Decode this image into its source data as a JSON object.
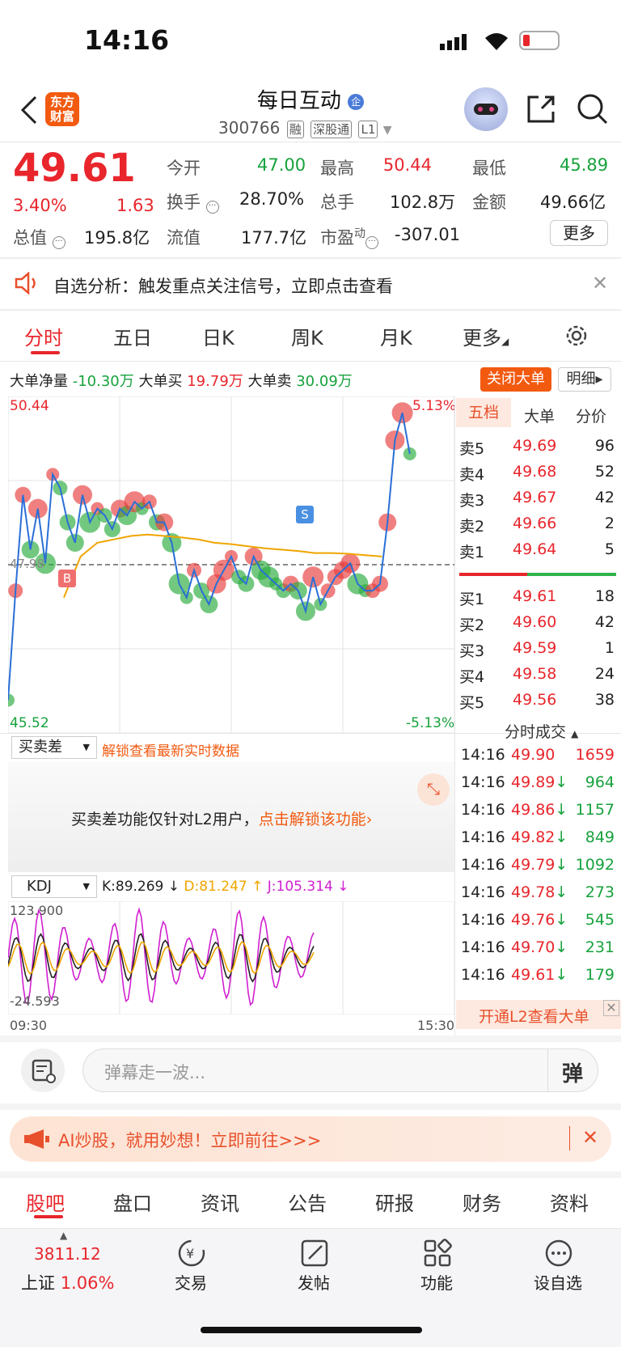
{
  "status_bar": {
    "time": "14:16"
  },
  "header": {
    "logo": "东方\n财富",
    "stock_name": "每日互动",
    "stock_code": "300766",
    "tags": [
      "融",
      "深股通",
      "L1"
    ]
  },
  "quote": {
    "price": "49.61",
    "change_pct": "3.40%",
    "change": "1.63",
    "open_label": "今开",
    "open": "47.00",
    "high_label": "最高",
    "high": "50.44",
    "low_label": "最低",
    "low": "45.89",
    "turnover_label": "换手",
    "turnover": "28.70%",
    "volume_label": "总手",
    "volume": "102.8万",
    "amount_label": "金额",
    "amount": "49.66亿",
    "mktcap_label": "总值",
    "mktcap": "195.8亿",
    "float_label": "流值",
    "float": "177.7亿",
    "pe_label": "市盈",
    "pe_sup": "动",
    "pe": "-307.01",
    "more": "更多"
  },
  "notice": {
    "text": "自选分析：触发重点关注信号，立即点击查看"
  },
  "tabs": [
    "分时",
    "五日",
    "日K",
    "周K",
    "月K",
    "更多"
  ],
  "bigorder": {
    "net_label": "大单净量",
    "net": "-10.30万",
    "buy_label": "大单买",
    "buy": "19.79万",
    "sell_label": "大单卖",
    "sell": "30.09万",
    "close_btn": "关闭大单",
    "detail_btn": "明细"
  },
  "chart": {
    "y_top": "50.44",
    "y_bottom": "45.52",
    "pct_top": "5.13%",
    "pct_bottom": "-5.13%",
    "prev_close": "47.98",
    "buy_marker": "B",
    "sell_marker": "S"
  },
  "chart_data": {
    "type": "line",
    "ylim": [
      45.52,
      50.44
    ],
    "x": [
      0,
      4,
      8,
      12,
      16,
      20,
      24,
      28,
      32,
      36,
      40,
      44,
      48,
      52,
      56,
      60,
      64,
      68,
      72,
      76,
      80,
      84,
      88,
      92,
      96,
      100,
      104,
      108,
      112,
      116,
      120,
      124,
      128,
      132,
      136,
      140,
      144,
      148,
      152,
      156,
      160,
      164,
      168,
      172,
      176,
      180,
      184,
      188,
      192,
      196,
      200,
      204,
      208,
      212,
      216,
      220,
      224,
      228,
      232,
      236,
      240
    ],
    "values": [
      46.0,
      47.6,
      49.0,
      48.2,
      48.8,
      48.0,
      49.3,
      49.1,
      48.6,
      48.3,
      49.0,
      48.6,
      48.8,
      48.7,
      48.5,
      48.8,
      48.7,
      48.9,
      48.8,
      48.9,
      48.6,
      48.6,
      48.3,
      47.7,
      47.5,
      47.9,
      47.6,
      47.4,
      47.7,
      47.9,
      48.1,
      47.8,
      47.7,
      48.1,
      47.9,
      47.8,
      47.7,
      47.6,
      47.7,
      47.6,
      47.3,
      47.8,
      47.4,
      47.6,
      47.8,
      47.9,
      48.0,
      47.7,
      47.6,
      47.6,
      47.7,
      48.6,
      49.8,
      50.2,
      49.6
    ],
    "avg_line": [
      47.5,
      48.1,
      48.3,
      48.35,
      48.4,
      48.42,
      48.4,
      48.38,
      48.35,
      48.3,
      48.28,
      48.25,
      48.22,
      48.2,
      48.18,
      48.15,
      48.15,
      48.14,
      48.12,
      48.1
    ]
  },
  "buysell": {
    "select": "买卖差",
    "unlock": "解锁查看最新实时数据",
    "msg": "买卖差功能仅针对L2用户，",
    "link": "点击解锁该功能"
  },
  "kdj": {
    "select": "KDJ",
    "k": "K:89.269 ↓",
    "d": "D:81.247 ↑",
    "j": "J:105.314 ↓",
    "max": "123.900",
    "min": "-24.593",
    "t_start": "09:30",
    "t_end": "15:30"
  },
  "orderbook": {
    "tabs": [
      "五档",
      "大单",
      "分价"
    ],
    "asks": [
      {
        "label": "卖5",
        "price": "49.69",
        "vol": "96"
      },
      {
        "label": "卖4",
        "price": "49.68",
        "vol": "52"
      },
      {
        "label": "卖3",
        "price": "49.67",
        "vol": "42"
      },
      {
        "label": "卖2",
        "price": "49.66",
        "vol": "2"
      },
      {
        "label": "卖1",
        "price": "49.64",
        "vol": "5"
      }
    ],
    "bids": [
      {
        "label": "买1",
        "price": "49.61",
        "vol": "18"
      },
      {
        "label": "买2",
        "price": "49.60",
        "vol": "42"
      },
      {
        "label": "买3",
        "price": "49.59",
        "vol": "1"
      },
      {
        "label": "买4",
        "price": "49.58",
        "vol": "24"
      },
      {
        "label": "买5",
        "price": "49.56",
        "vol": "38"
      }
    ]
  },
  "trades": {
    "title": "分时成交",
    "rows": [
      {
        "t": "14:16",
        "p": "49.90",
        "arrow": "",
        "v": "1659",
        "c": "red"
      },
      {
        "t": "14:16",
        "p": "49.89",
        "arrow": "↓",
        "v": "964",
        "c": "green"
      },
      {
        "t": "14:16",
        "p": "49.86",
        "arrow": "↓",
        "v": "1157",
        "c": "green"
      },
      {
        "t": "14:16",
        "p": "49.82",
        "arrow": "↓",
        "v": "849",
        "c": "green"
      },
      {
        "t": "14:16",
        "p": "49.79",
        "arrow": "↓",
        "v": "1092",
        "c": "green"
      },
      {
        "t": "14:16",
        "p": "49.78",
        "arrow": "↓",
        "v": "273",
        "c": "green"
      },
      {
        "t": "14:16",
        "p": "49.76",
        "arrow": "↓",
        "v": "545",
        "c": "green"
      },
      {
        "t": "14:16",
        "p": "49.70",
        "arrow": "↓",
        "v": "231",
        "c": "green"
      },
      {
        "t": "14:16",
        "p": "49.61",
        "arrow": "↓",
        "v": "179",
        "c": "green"
      }
    ],
    "l2_banner": "开通L2查看大单"
  },
  "danmu": {
    "placeholder": "弹幕走一波...",
    "btn": "弹"
  },
  "ai_banner": {
    "text": "AI炒股，就用妙想！立即前往>>>"
  },
  "bottom_tabs": [
    "股吧",
    "盘口",
    "资讯",
    "公告",
    "研报",
    "财务",
    "资料"
  ],
  "bottom_nav": {
    "index_value": "3811.12",
    "index_name": "上证",
    "index_pct": "1.06%",
    "items": [
      "交易",
      "发帖",
      "功能",
      "设自选"
    ]
  }
}
